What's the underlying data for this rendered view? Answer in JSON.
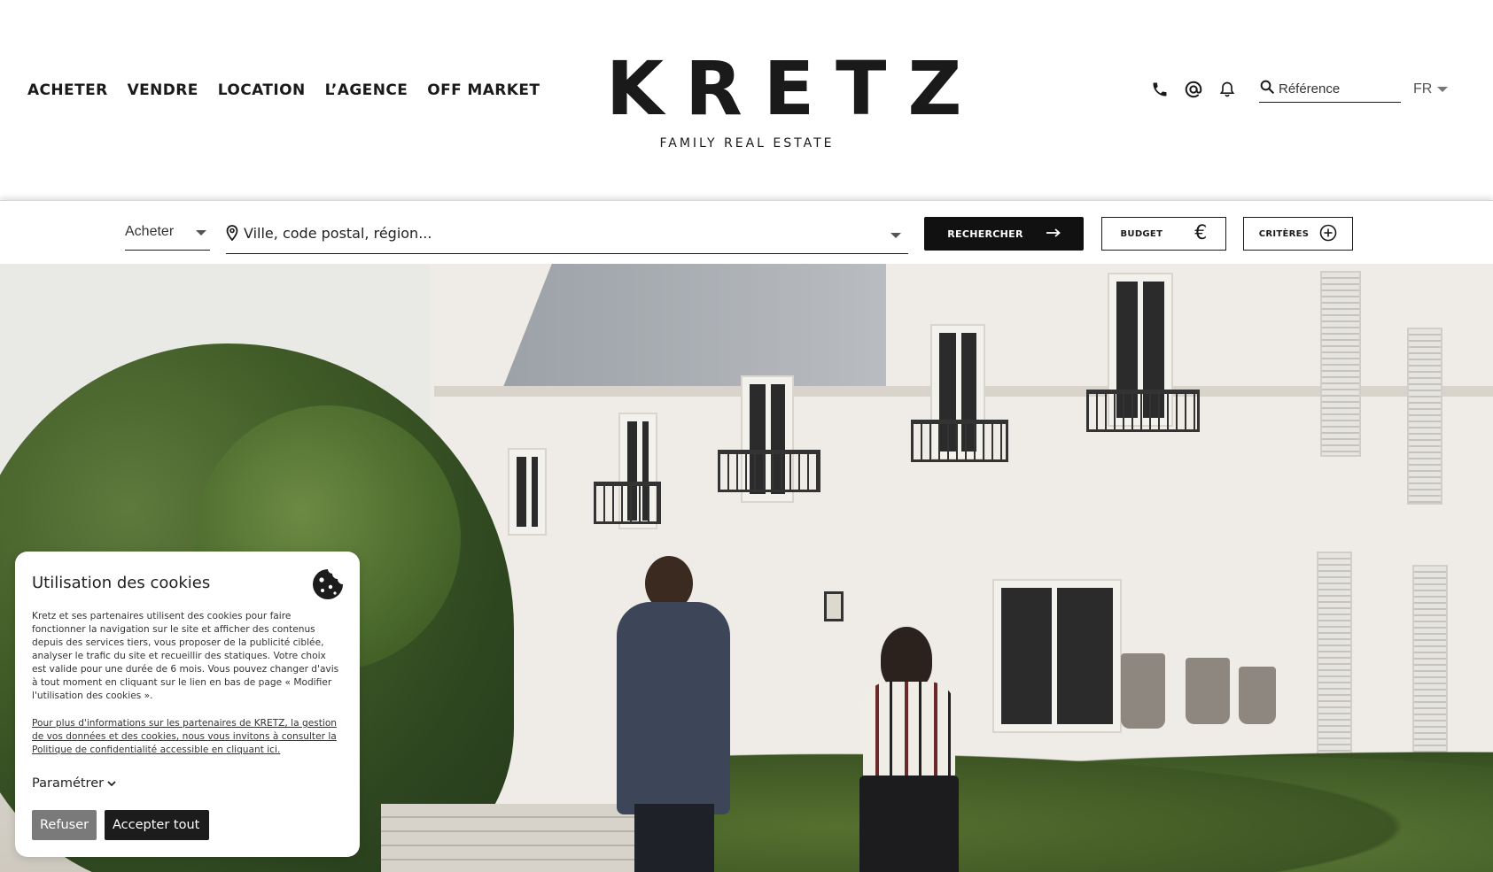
{
  "nav": {
    "items": [
      "ACHETER",
      "VENDRE",
      "LOCATION",
      "L’AGENCE",
      "OFF MARKET"
    ]
  },
  "logo": {
    "word": "KRETZ",
    "tagline": "FAMILY REAL ESTATE"
  },
  "tools": {
    "icons": [
      "phone-icon",
      "at-icon",
      "bell-icon",
      "search-icon"
    ],
    "reference_placeholder": "Référence",
    "language": "FR"
  },
  "search": {
    "transaction_type": "Acheter",
    "location_placeholder": "Ville, code postal, région...",
    "search_button": "RECHERCHER",
    "budget_button": "BUDGET",
    "criteria_button": "CRITÈRES"
  },
  "cookies": {
    "title": "Utilisation des cookies",
    "body": "Kretz et ses partenaires utilisent des cookies pour faire fonctionner la navigation sur le site et afficher des contenus depuis des services tiers, vous proposer de la publicité ciblée, analyser le trafic du site et recueillir des statiques. Votre choix est valide pour une durée de 6 mois. Vous pouvez changer d'avis à tout moment en cliquant sur le lien en bas de page « Modifier l'utilisation des cookies ».",
    "privacy_link": "Pour plus d'informations sur les partenaires de KRETZ, la gestion de vos données et des cookies, nous vous invitons à consulter la Politique de confidentialité accessible en cliquant ici.",
    "settings_label": "Paramétrer",
    "refuse_label": "Refuser",
    "accept_label": "Accepter tout"
  },
  "colors": {
    "brand_dark": "#1a1a1a",
    "search_button_bg": "#111111",
    "refuse_button_bg": "#7a7a7a",
    "accept_button_bg": "#1c1c1c"
  }
}
